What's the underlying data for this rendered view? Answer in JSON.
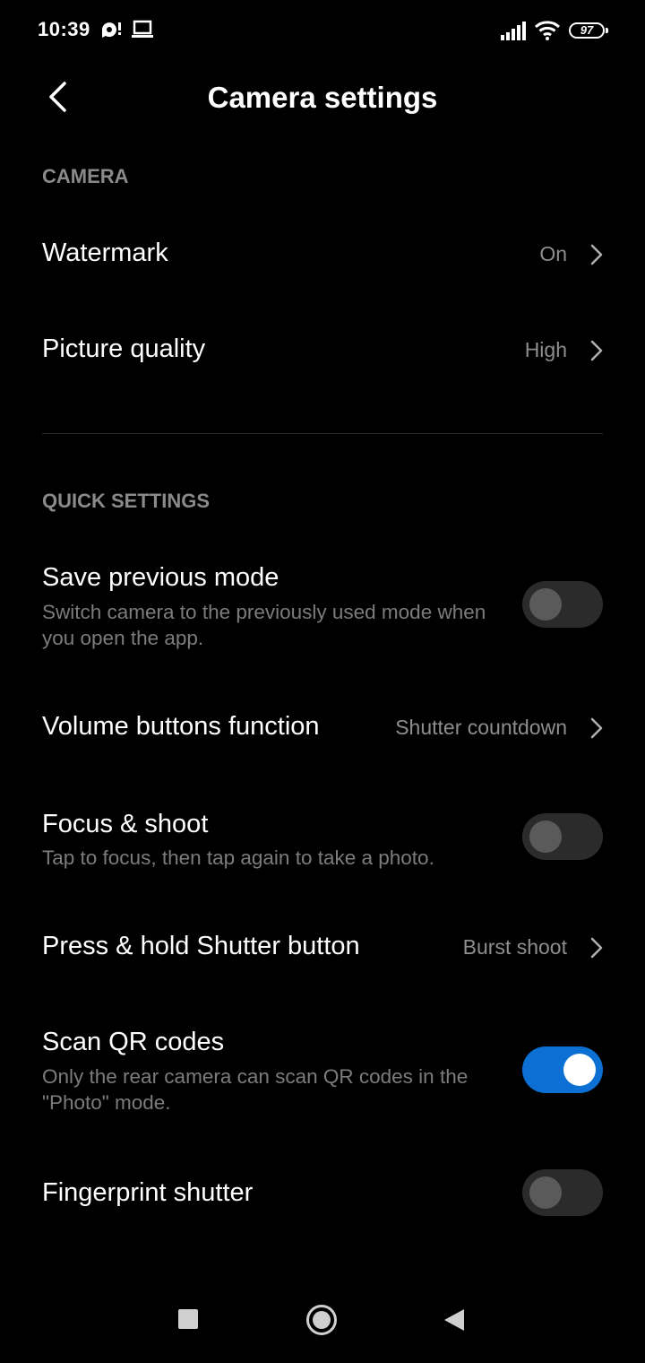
{
  "status_bar": {
    "time": "10:39",
    "battery": "97",
    "icons": [
      "notification-icon",
      "laptop-icon",
      "signal-icon",
      "wifi-icon",
      "battery-icon"
    ]
  },
  "header": {
    "title": "Camera settings",
    "back_icon": "chevron-left-icon"
  },
  "sections": {
    "camera": "CAMERA",
    "quick_settings": "QUICK SETTINGS"
  },
  "rows": {
    "watermark": {
      "title": "Watermark",
      "value": "On"
    },
    "picture_quality": {
      "title": "Picture quality",
      "value": "High"
    },
    "save_previous_mode": {
      "title": "Save previous mode",
      "description": "Switch camera to the previously used mode when you open the app.",
      "enabled": false
    },
    "volume_buttons": {
      "title": "Volume buttons function",
      "value": "Shutter countdown"
    },
    "focus_shoot": {
      "title": "Focus & shoot",
      "description": "Tap to focus, then tap again to take a photo.",
      "enabled": false
    },
    "press_hold_shutter": {
      "title": "Press & hold Shutter button",
      "value": "Burst shoot"
    },
    "scan_qr": {
      "title": "Scan QR codes",
      "description": "Only the rear camera can scan QR codes in the \"Photo\" mode.",
      "enabled": true
    },
    "fingerprint_shutter": {
      "title": "Fingerprint shutter",
      "enabled": false
    }
  },
  "colors": {
    "background": "#000000",
    "accent": "#0b6fd3",
    "secondary_text": "#7c7c7c",
    "section_label": "#8a8a8a"
  },
  "nav_bar": {
    "icons": [
      "recents-square-icon",
      "home-circle-icon",
      "back-triangle-icon"
    ]
  }
}
